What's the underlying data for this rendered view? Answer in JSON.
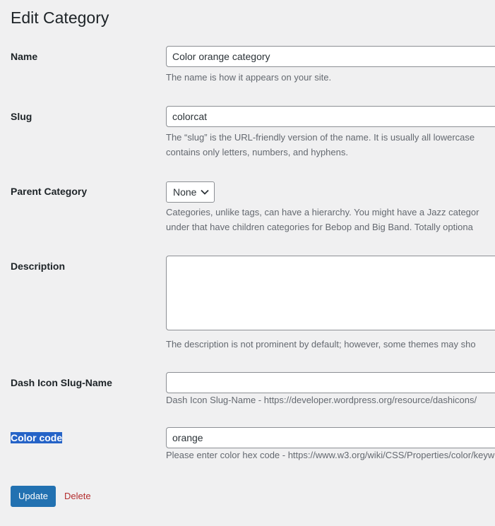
{
  "page": {
    "title": "Edit Category"
  },
  "form": {
    "name": {
      "label": "Name",
      "value": "Color orange category",
      "help": "The name is how it appears on your site."
    },
    "slug": {
      "label": "Slug",
      "value": "colorcat",
      "help_line1": "The “slug” is the URL-friendly version of the name. It is usually all lowercase",
      "help_line2": "contains only letters, numbers, and hyphens."
    },
    "parent": {
      "label": "Parent Category",
      "selected": "None",
      "help_line1": "Categories, unlike tags, can have a hierarchy. You might have a Jazz categor",
      "help_line2": "under that have children categories for Bebop and Big Band. Totally optiona"
    },
    "description": {
      "label": "Description",
      "value": "",
      "help": "The description is not prominent by default; however, some themes may sho"
    },
    "dash_icon": {
      "label": "Dash Icon Slug-Name",
      "value": "",
      "help": "Dash Icon Slug-Name - https://developer.wordpress.org/resource/dashicons/"
    },
    "color_code": {
      "label": "Color code",
      "value": "orange",
      "help": "Please enter color hex code - https://www.w3.org/wiki/CSS/Properties/color/keyw"
    }
  },
  "actions": {
    "update_label": "Update",
    "delete_label": "Delete"
  },
  "colors": {
    "background": "#f0f0f1",
    "primary_button": "#2271b1",
    "delete_link": "#b32d2e",
    "selection_highlight": "#2563c7"
  }
}
